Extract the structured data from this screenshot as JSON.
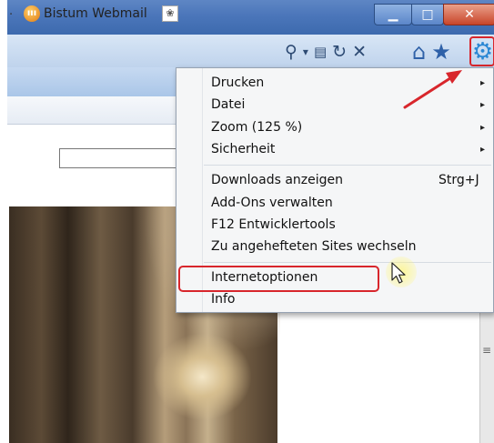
{
  "window": {
    "min_glyph": "▁",
    "max_glyph": "□",
    "close_glyph": "✕"
  },
  "navbar": {
    "search_glyph": "⚲",
    "dropdown_glyph": "▾",
    "compat_glyph": "▤",
    "refresh_glyph": "↻",
    "stop_glyph": "✕",
    "home_glyph": "⌂",
    "favorites_glyph": "★",
    "tools_glyph": "⚙"
  },
  "favorites_bar": {
    "left_marker": ".",
    "webmail_icon_text": "ııı",
    "webmail_label": "Bistum Webmail",
    "extra_icon": "❀"
  },
  "menu": {
    "items": [
      {
        "label": "Drucken",
        "has_submenu": true
      },
      {
        "label": "Datei",
        "has_submenu": true
      },
      {
        "label": "Zoom (125 %)",
        "has_submenu": true
      },
      {
        "label": "Sicherheit",
        "has_submenu": true
      },
      {
        "label": "Downloads anzeigen",
        "shortcut": "Strg+J"
      },
      {
        "label": "Add-Ons verwalten"
      },
      {
        "label": "F12 Entwicklertools"
      },
      {
        "label": "Zu angehefteten Sites wechseln"
      },
      {
        "label": "Internetoptionen"
      },
      {
        "label": "Info"
      }
    ],
    "arrow_glyph": "▸"
  },
  "annotation": {
    "highlight_color": "#d8262c"
  },
  "scrollbar": {
    "grip_glyph": "≡"
  }
}
